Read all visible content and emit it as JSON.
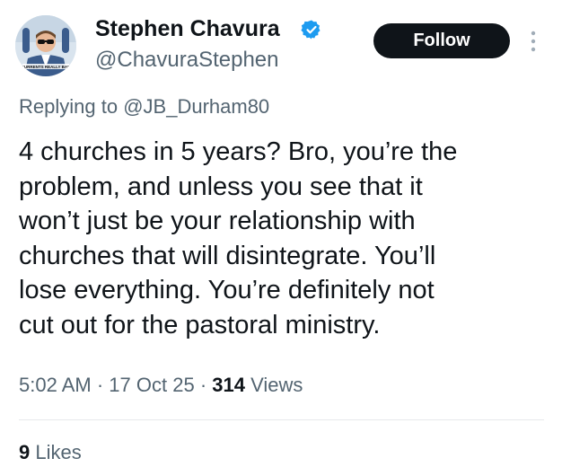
{
  "user": {
    "display_name": "Stephen Chavura",
    "handle": "@ChavuraStephen",
    "avatar_caption": "CURRENTS REALLY BAD",
    "verified": true,
    "verified_color": "#1d9bf0"
  },
  "header": {
    "follow_label": "Follow",
    "more_icon": "more-vertical-icon"
  },
  "reply": {
    "prefix": "Replying to",
    "mention": "@JB_Durham80"
  },
  "tweet": {
    "lines": [
      "4 churches in 5 years? Bro, you’re the",
      "problem, and unless you see that it",
      "won’t just be your relationship with",
      "churches that will disintegrate. You’ll",
      "lose everything. You’re definitely not",
      "cut out for the pastoral ministry."
    ]
  },
  "meta": {
    "time": "5:02 AM",
    "separator": "·",
    "date": "17 Oct 25",
    "views_count": "314",
    "views_label": "Views"
  },
  "engagement": {
    "likes_count": "9",
    "likes_label": "Likes"
  },
  "colors": {
    "text": "#0f1419",
    "secondary": "#536471",
    "button_bg": "#0f1419",
    "divider": "#e6e9eb"
  }
}
